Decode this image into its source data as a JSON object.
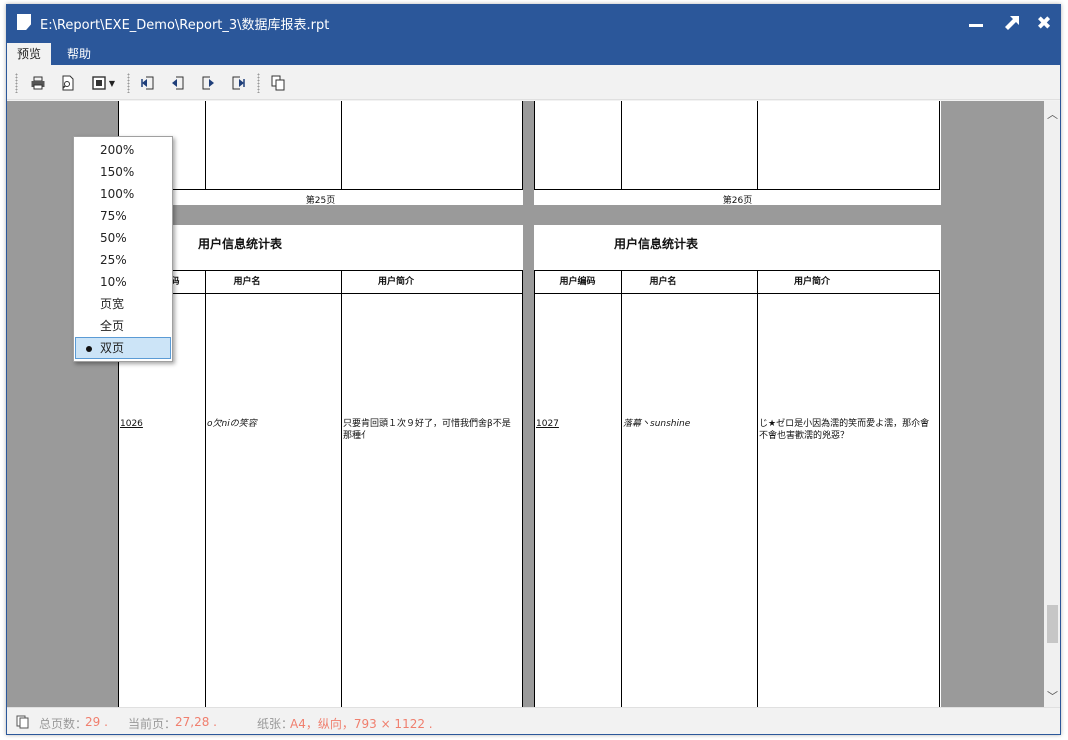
{
  "window": {
    "title": "E:\\Report\\EXE_Demo\\Report_3\\数据库报表.rpt"
  },
  "menu": {
    "items": [
      {
        "label": "预览"
      },
      {
        "label": "帮助"
      }
    ]
  },
  "report": {
    "title": "用户信息统计表",
    "columns": [
      "用户编码",
      "用户名",
      "用户简介"
    ],
    "pages": [
      {
        "footer": "第25页",
        "row": {
          "id": "1026",
          "name": "o欠niの笑容",
          "intro": "只要肯回頭１次９好了，可惜我們舍β不是那種亻"
        }
      },
      {
        "footer": "第26页",
        "row": {
          "id": "1027",
          "name": "落幕丶sunshine",
          "intro": "じ★ゼロ是小因為濡的笑而愛よ濡，那尒會不會也害歡濡的兇惡？"
        }
      }
    ]
  },
  "zoom_menu": {
    "options": [
      "200%",
      "150%",
      "100%",
      "75%",
      "50%",
      "25%",
      "10%",
      "页宽",
      "全页",
      "双页"
    ],
    "selected": "双页"
  },
  "status": {
    "total_label": "总页数：",
    "total_value": "29 .",
    "current_label": "当前页：",
    "current_value": "27,28 .",
    "paper_label": "纸张：",
    "paper_value": "A4，纵向，793 × 1122 ."
  },
  "colors": {
    "title_bar": "#2b579a",
    "status_value": "#f07f6e",
    "selected_menu": "#cce4f7"
  }
}
